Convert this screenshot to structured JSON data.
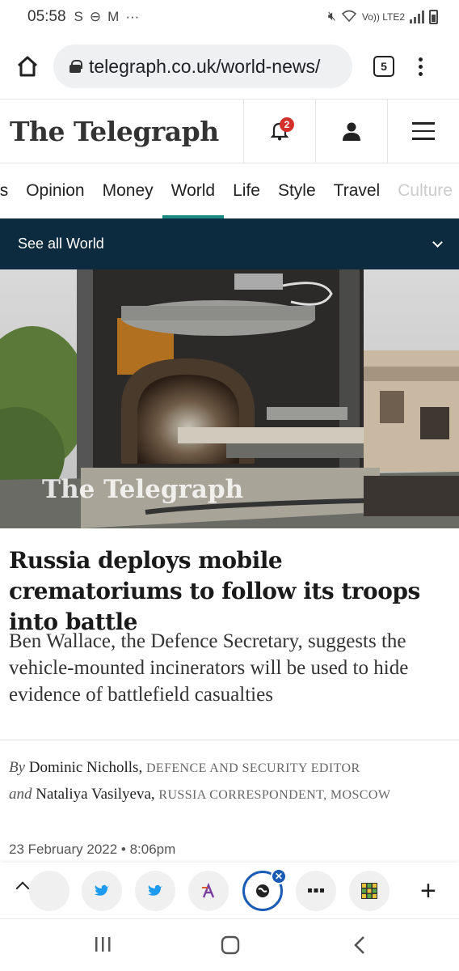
{
  "status_bar": {
    "time": "05:58",
    "notif_icons": [
      "S",
      "⊖",
      "M",
      "···"
    ],
    "network": "Vo)) LTE2"
  },
  "browser": {
    "url": "telegraph.co.uk/world-news/",
    "tab_count": "5"
  },
  "header": {
    "logo": "The Telegraph",
    "notification_count": "2"
  },
  "nav": {
    "items": [
      {
        "label": "Business"
      },
      {
        "label": "Opinion"
      },
      {
        "label": "Money"
      },
      {
        "label": "World"
      },
      {
        "label": "Life"
      },
      {
        "label": "Style"
      },
      {
        "label": "Travel"
      },
      {
        "label": "Culture"
      }
    ],
    "active": "World"
  },
  "subnav": {
    "label": "See all World"
  },
  "hero": {
    "watermark": "The Telegraph"
  },
  "article": {
    "headline": "Russia deploys mobile crematoriums to follow its troops into battle",
    "standfirst": "Ben Wallace, the Defence Secretary, suggests the vehicle-mounted incinerators will be used to hide evidence of battlefield casualties",
    "byline": {
      "by": "By",
      "author1": "Dominic Nicholls",
      "role1": "DEFENCE AND SECURITY EDITOR",
      "and": "and",
      "author2": "Nataliya Vasilyeva",
      "role2": "RUSSIA CORRESPONDENT, MOSCOW"
    },
    "date": "23 February 2022 • 8:06pm"
  },
  "colors": {
    "accent": "#1c8a84",
    "dark_nav": "#0d2b3e",
    "badge": "#d4302b",
    "twitter": "#1d9bf0",
    "active_ring": "#1a5bb5"
  }
}
